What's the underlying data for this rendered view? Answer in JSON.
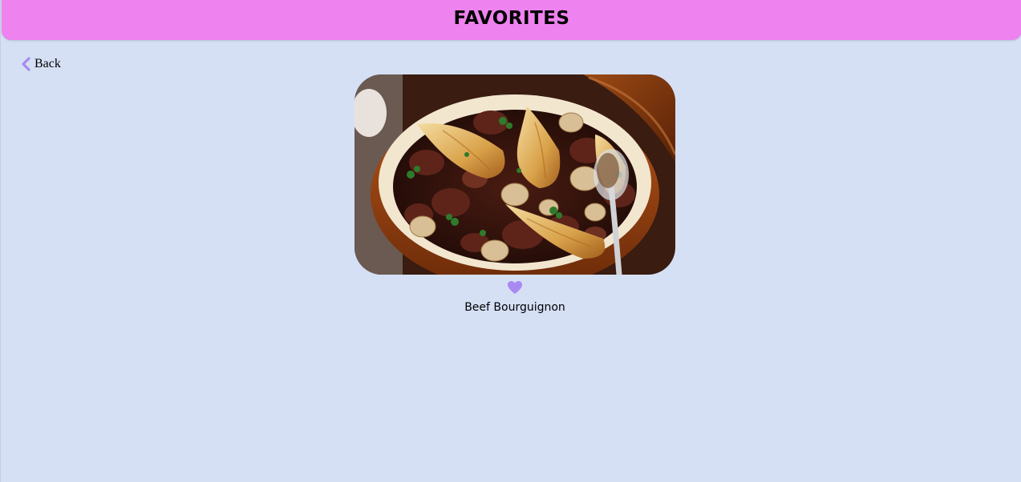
{
  "header": {
    "title": "FAVORITES",
    "color": "#ee82ee"
  },
  "nav": {
    "back_label": "Back",
    "back_icon": "chevron-left-icon",
    "accent_color": "#a98af2"
  },
  "favorites": [
    {
      "name": "Beef Bourguignon",
      "image": "beef-bourguignon-photo",
      "favorited": true,
      "heart_icon": "heart-icon"
    }
  ],
  "page": {
    "background": "#d5e0f5"
  }
}
